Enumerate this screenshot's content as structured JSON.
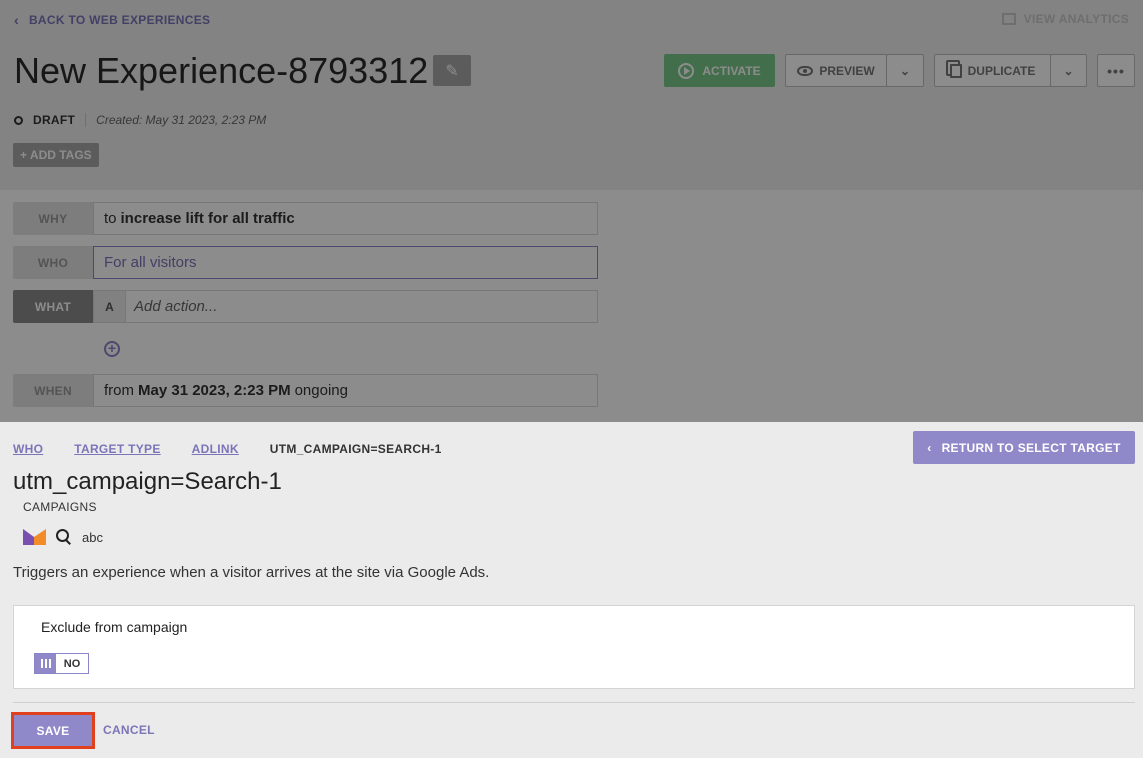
{
  "header": {
    "back_label": "BACK TO WEB EXPERIENCES",
    "view_analytics_label": "VIEW ANALYTICS",
    "title": "New Experience-8793312",
    "status": "DRAFT",
    "created": "Created: May 31 2023, 2:23 PM",
    "add_tags_label": "+ ADD TAGS"
  },
  "actions": {
    "activate_label": "ACTIVATE",
    "preview_label": "PREVIEW",
    "duplicate_label": "DUPLICATE",
    "more_label": "•••"
  },
  "rules": {
    "why_label": "WHY",
    "why_prefix": "to",
    "why_value": "increase lift for all traffic",
    "who_label": "WHO",
    "who_value": "For all visitors",
    "what_label": "WHAT",
    "what_tag": "A",
    "what_placeholder": "Add action...",
    "when_label": "WHEN",
    "when_prefix": "from",
    "when_date": "May 31 2023, 2:23 PM",
    "when_suffix": "ongoing"
  },
  "panel": {
    "breadcrumbs": [
      "WHO",
      "TARGET TYPE",
      "ADLINK"
    ],
    "breadcrumb_current": "UTM_CAMPAIGN=SEARCH-1",
    "return_label": "RETURN TO SELECT TARGET",
    "title": "utm_campaign=Search-1",
    "campaigns_label": "CAMPAIGNS",
    "search_value": "abc",
    "description": "Triggers an experience when a visitor arrives at the site via Google Ads.",
    "exclude_label": "Exclude from campaign",
    "toggle_text": "NO",
    "save_label": "SAVE",
    "cancel_label": "CANCEL"
  },
  "colors": {
    "accent": "#8f88c9",
    "activate": "#7bc98a",
    "highlight": "#e0401e"
  }
}
